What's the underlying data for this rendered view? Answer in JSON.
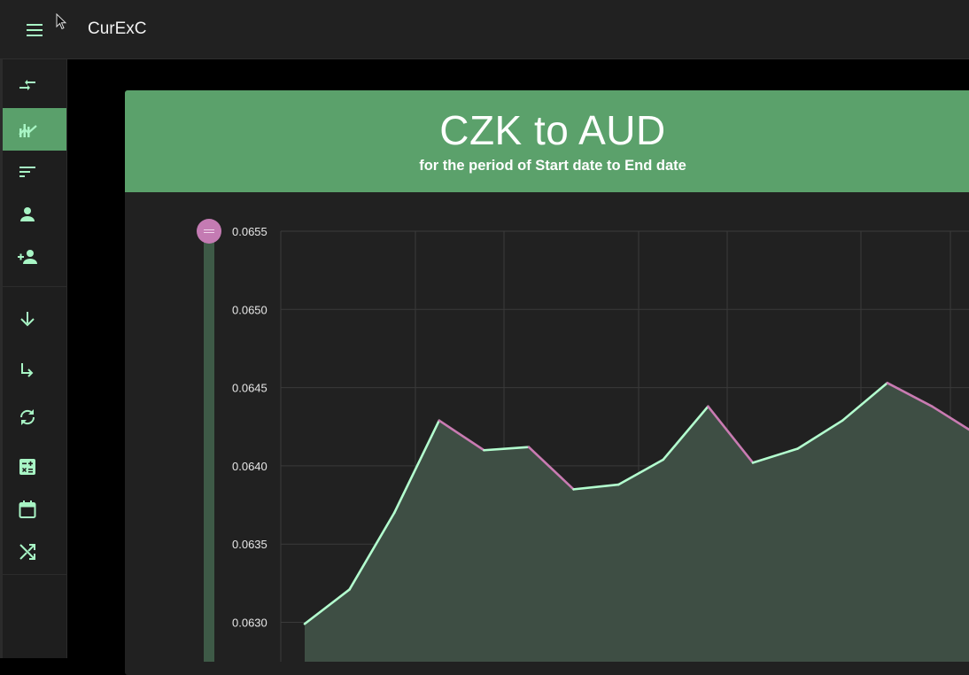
{
  "app": {
    "title": "CurExC"
  },
  "sidebar": {
    "items": [
      {
        "icon": "compare-arrows-icon",
        "active": false
      },
      {
        "icon": "trending-chart-icon",
        "active": true
      },
      {
        "icon": "sort-icon",
        "active": false
      },
      {
        "icon": "person-icon",
        "active": false
      },
      {
        "icon": "person-add-icon",
        "active": false
      },
      {
        "icon": "arrow-down-icon",
        "active": false
      },
      {
        "icon": "subdirectory-arrow-icon",
        "active": false
      },
      {
        "icon": "sync-icon",
        "active": false
      },
      {
        "icon": "calculator-icon",
        "active": false
      },
      {
        "icon": "calendar-icon",
        "active": false
      },
      {
        "icon": "shuffle-icon",
        "active": false
      }
    ]
  },
  "card": {
    "title": "CZK to AUD",
    "subtitle": "for the period of Start date to End date"
  },
  "colors": {
    "header_green": "#5ba16b",
    "line_mint": "#b3ffcf",
    "line_pink": "#c97bb2",
    "area_fill": "#3e4e44"
  },
  "chart_data": {
    "type": "area",
    "title": "CZK to AUD",
    "ylabel": "",
    "xlabel": "",
    "ylim": [
      0.0625,
      0.0655
    ],
    "yticks": [
      "0.0655",
      "0.0650",
      "0.0645",
      "0.0640",
      "0.0635",
      "0.0630"
    ],
    "grid": true,
    "slider": {
      "level": 1.0
    },
    "values": [
      0.06299,
      0.06321,
      0.0637,
      0.06429,
      0.0641,
      0.06412,
      0.06385,
      0.06388,
      0.06404,
      0.06438,
      0.06402,
      0.06411,
      0.06429,
      0.06453,
      0.06438,
      0.0642
    ]
  }
}
